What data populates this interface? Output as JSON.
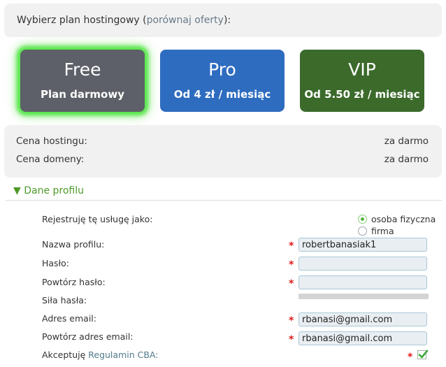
{
  "header": {
    "text": "Wybierz plan hostingowy (",
    "link": "porównaj oferty",
    "suffix": "):"
  },
  "plans": [
    {
      "name": "Free",
      "price": "Plan darmowy",
      "selected": true,
      "color": "#5d6068"
    },
    {
      "name": "Pro",
      "price": "Od 4 zł / miesiąc",
      "selected": false,
      "color": "#2e6cc0"
    },
    {
      "name": "VIP",
      "price": "Od 5.50 zł / miesiąc",
      "selected": false,
      "color": "#3b6a2b"
    }
  ],
  "pricing": {
    "hosting_label": "Cena hostingu:",
    "hosting_value": "za darmo",
    "domain_label": "Cena domeny:",
    "domain_value": "za darmo"
  },
  "section": {
    "title": "▼ Dane profilu"
  },
  "form": {
    "register_as_label": "Rejestruję tę usługę jako:",
    "radio_options": [
      {
        "label": "osoba fizyczna",
        "checked": true
      },
      {
        "label": "firma",
        "checked": false
      }
    ],
    "profile_name_label": "Nazwa profilu:",
    "profile_name_value": "robertbanasiak1",
    "password_label": "Hasło:",
    "password_value": "",
    "repeat_password_label": "Powtórz hasło:",
    "repeat_password_value": "",
    "password_strength_label": "Siła hasła:",
    "email_label": "Adres email:",
    "email_value": "rbanasi@gmail.com",
    "repeat_email_label": "Powtórz adres email:",
    "repeat_email_value": "rbanasi@gmail.com",
    "accept_prefix": "Akceptuję",
    "accept_link": "Regulamin CBA:",
    "accept_checked": true,
    "required_mark": "*"
  },
  "colors": {
    "accent_green": "#4f9a2b",
    "required": "#e01b1b",
    "selected_glow": "#56e64a"
  }
}
